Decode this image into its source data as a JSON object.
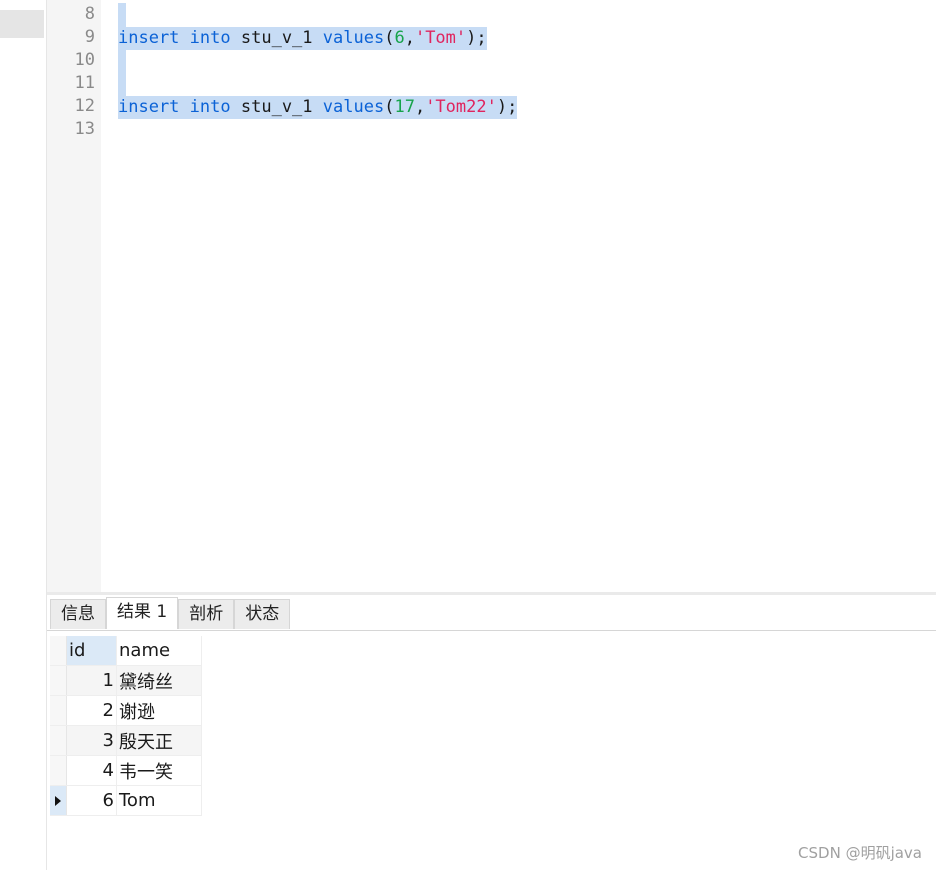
{
  "editor": {
    "line_numbers": [
      "8",
      "9",
      "10",
      "11",
      "12",
      "13"
    ],
    "line9": {
      "kw1": "insert",
      "kw2": "into",
      "table": "stu_v_1",
      "kw3": "values",
      "open": "(",
      "num": "6",
      "comma": ",",
      "str": "'Tom'",
      "close": ");"
    },
    "line12": {
      "kw1": "insert",
      "kw2": "into",
      "table": "stu_v_1",
      "kw3": "values",
      "open": "(",
      "num": "17",
      "comma": ",",
      "str": "'Tom22'",
      "close": ");"
    }
  },
  "tabs": [
    {
      "label": "信息",
      "active": false
    },
    {
      "label": "结果 1",
      "active": true
    },
    {
      "label": "剖析",
      "active": false
    },
    {
      "label": "状态",
      "active": false
    }
  ],
  "result": {
    "columns": [
      "id",
      "name"
    ],
    "rows": [
      {
        "id": "1",
        "name": "黛绮丝"
      },
      {
        "id": "2",
        "name": "谢逊"
      },
      {
        "id": "3",
        "name": "殷天正"
      },
      {
        "id": "4",
        "name": "韦一笑"
      },
      {
        "id": "6",
        "name": "Tom"
      }
    ]
  },
  "watermark": "CSDN @明矾java"
}
